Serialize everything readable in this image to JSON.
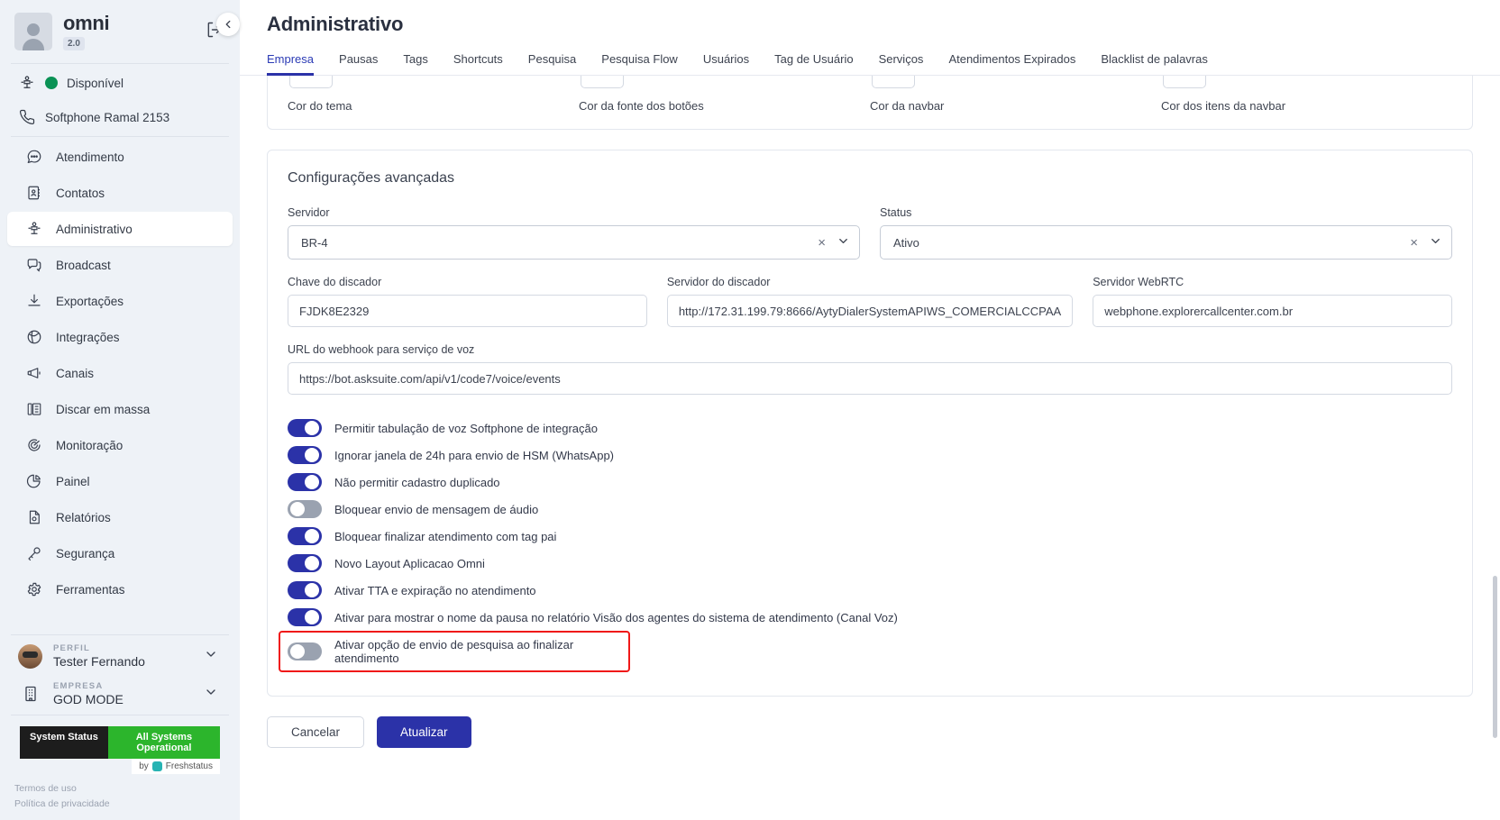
{
  "sidebar": {
    "brand": {
      "name": "omni",
      "version": "2.0"
    },
    "status": {
      "label": "Disponível",
      "color": "#0a9255"
    },
    "softphone": {
      "label": "Softphone Ramal 2153"
    },
    "items": [
      {
        "label": "Atendimento",
        "icon": "chat-icon",
        "active": false
      },
      {
        "label": "Contatos",
        "icon": "contacts-icon",
        "active": false
      },
      {
        "label": "Administrativo",
        "icon": "admin-icon",
        "active": true
      },
      {
        "label": "Broadcast",
        "icon": "broadcast-icon",
        "active": false
      },
      {
        "label": "Exportações",
        "icon": "download-icon",
        "active": false
      },
      {
        "label": "Integrações",
        "icon": "integrations-icon",
        "active": false
      },
      {
        "label": "Canais",
        "icon": "megaphone-icon",
        "active": false
      },
      {
        "label": "Discar em massa",
        "icon": "dialpad-icon",
        "active": false
      },
      {
        "label": "Monitoração",
        "icon": "target-icon",
        "active": false
      },
      {
        "label": "Painel",
        "icon": "piechart-icon",
        "active": false
      },
      {
        "label": "Relatórios",
        "icon": "report-icon",
        "active": false
      },
      {
        "label": "Segurança",
        "icon": "key-icon",
        "active": false
      },
      {
        "label": "Ferramentas",
        "icon": "gear-icon",
        "active": false
      }
    ],
    "profile": {
      "caption": "PERFIL",
      "name": "Tester Fernando"
    },
    "company": {
      "caption": "EMPRESA",
      "name": "GOD MODE"
    },
    "system_status": {
      "left": "System Status",
      "right": "All Systems Operational",
      "by": "by",
      "provider": "Freshstatus"
    },
    "legal": {
      "terms": "Termos de uso",
      "privacy": "Política de privacidade"
    }
  },
  "header": {
    "title": "Administrativo",
    "tabs": [
      {
        "label": "Empresa",
        "active": true
      },
      {
        "label": "Pausas",
        "active": false
      },
      {
        "label": "Tags",
        "active": false
      },
      {
        "label": "Shortcuts",
        "active": false
      },
      {
        "label": "Pesquisa",
        "active": false
      },
      {
        "label": "Pesquisa Flow",
        "active": false
      },
      {
        "label": "Usuários",
        "active": false
      },
      {
        "label": "Tag de Usuário",
        "active": false
      },
      {
        "label": "Serviços",
        "active": false
      },
      {
        "label": "Atendimentos Expirados",
        "active": false
      },
      {
        "label": "Blacklist de palavras",
        "active": false
      }
    ]
  },
  "colors_section": {
    "swatches": [
      {
        "label": "Cor do tema"
      },
      {
        "label": "Cor da fonte dos botões"
      },
      {
        "label": "Cor da navbar"
      },
      {
        "label": "Cor dos itens da navbar"
      }
    ]
  },
  "advanced": {
    "title": "Configurações avançadas",
    "servidor": {
      "label": "Servidor",
      "value": "BR-4"
    },
    "status": {
      "label": "Status",
      "value": "Ativo"
    },
    "chave_discador": {
      "label": "Chave do discador",
      "value": "FJDK8E2329"
    },
    "servidor_discador": {
      "label": "Servidor do discador",
      "value": "http://172.31.199.79:8666/AytyDialerSystemAPIWS_COMERCIALCCPAA"
    },
    "servidor_webrtc": {
      "label": "Servidor WebRTC",
      "value": "webphone.explorercallcenter.com.br"
    },
    "webhook": {
      "label": "URL do webhook para serviço de voz",
      "value": "https://bot.asksuite.com/api/v1/code7/voice/events"
    },
    "toggles": [
      {
        "label": "Permitir tabulação de voz Softphone de integração",
        "on": true,
        "highlight": false
      },
      {
        "label": "Ignorar janela de 24h para envio de HSM (WhatsApp)",
        "on": true,
        "highlight": false
      },
      {
        "label": "Não permitir cadastro duplicado",
        "on": true,
        "highlight": false
      },
      {
        "label": "Bloquear envio de mensagem de áudio",
        "on": false,
        "highlight": false
      },
      {
        "label": "Bloquear finalizar atendimento com tag pai",
        "on": true,
        "highlight": false
      },
      {
        "label": "Novo Layout Aplicacao Omni",
        "on": true,
        "highlight": false
      },
      {
        "label": "Ativar TTA e expiração no atendimento",
        "on": true,
        "highlight": false
      },
      {
        "label": "Ativar para mostrar o nome da pausa no relatório Visão dos agentes do sistema de atendimento (Canal Voz)",
        "on": true,
        "highlight": false
      },
      {
        "label": "Ativar opção de envio de pesquisa ao finalizar atendimento",
        "on": false,
        "highlight": true
      }
    ]
  },
  "footer": {
    "cancel": "Cancelar",
    "update": "Atualizar"
  },
  "theme": {
    "accent": "#2b32a8",
    "highlight": "#f01818",
    "sidebar_bg": "#eef2f7"
  }
}
